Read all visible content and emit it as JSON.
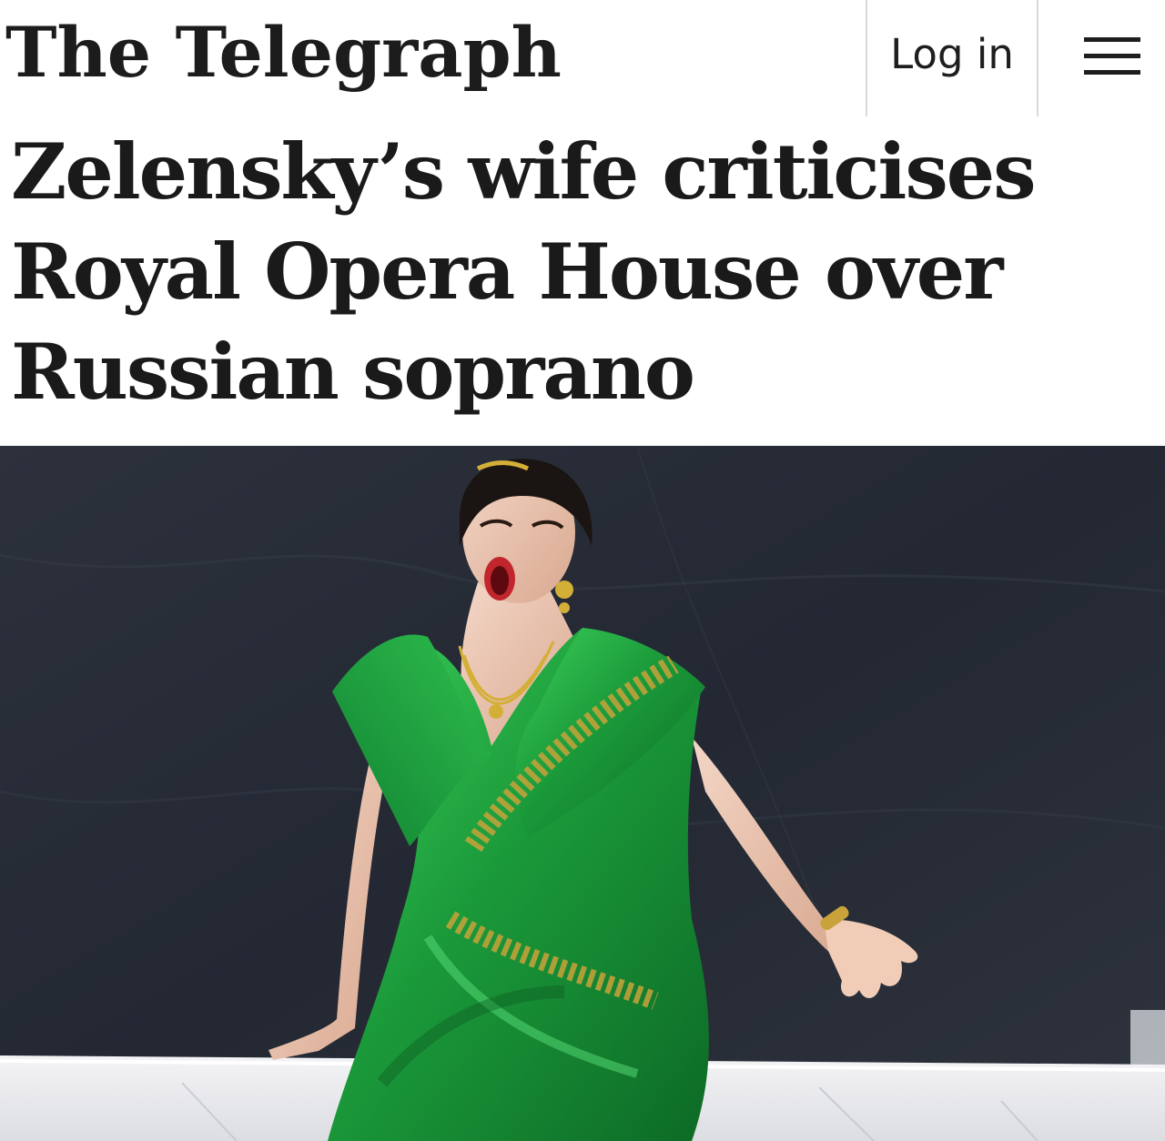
{
  "header": {
    "masthead": "The Telegraph",
    "login_label": "Log in",
    "menu_icon": "hamburger-menu-icon"
  },
  "article": {
    "headline": "Zelensky’s wife criticises Royal Opera House over Russian soprano"
  },
  "colors": {
    "text": "#1a1a1a",
    "backdrop": "#2a2f3a",
    "gown": "#1f9a3c",
    "gold": "#c9a23a"
  }
}
